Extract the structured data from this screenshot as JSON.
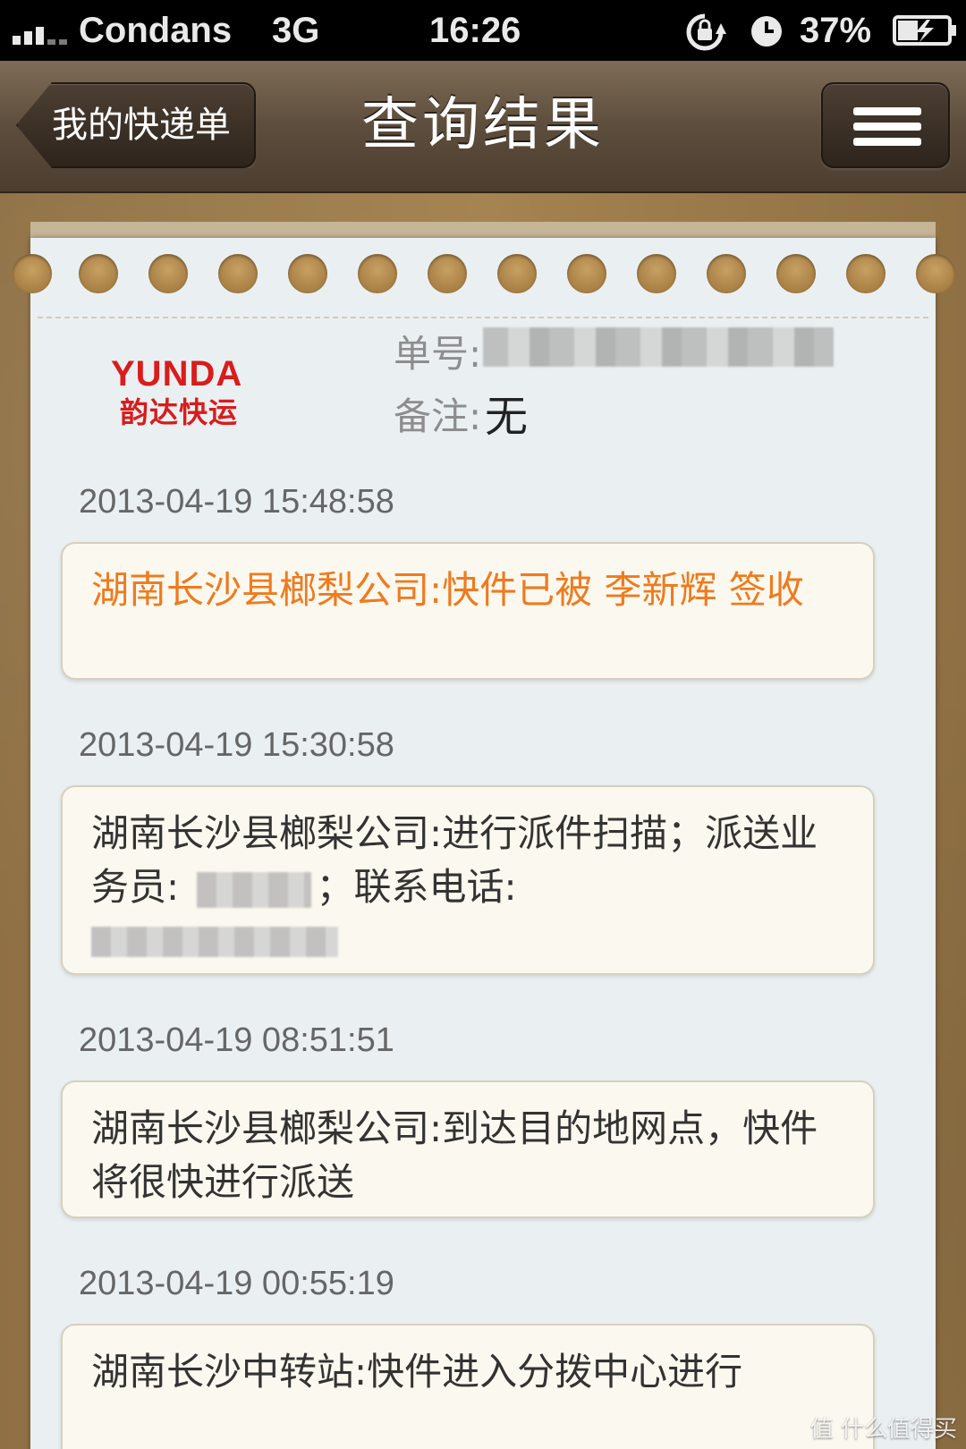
{
  "status_bar": {
    "carrier": "Condans",
    "network": "3G",
    "time": "16:26",
    "battery": "37%"
  },
  "nav": {
    "back_label": "我的快递单",
    "title": "查询结果",
    "menu_icon": "hamburger-menu-icon"
  },
  "shipment": {
    "logo_en": "YUNDA",
    "logo_cn": "韵达快运",
    "tracking_label": "单号:",
    "note_label": "备注:",
    "note_value": "无"
  },
  "events": [
    {
      "time": "2013-04-19 15:48:58",
      "text": "湖南长沙县榔梨公司:快件已被 李新辉 签收",
      "highlight": true
    },
    {
      "time": "2013-04-19 15:30:58",
      "text_a": "湖南长沙县榔梨公司:进行派件扫描；派送业务员:",
      "text_b": "；联系电话:",
      "highlight": false
    },
    {
      "time": "2013-04-19 08:51:51",
      "text": "湖南长沙县榔梨公司:到达目的地网点，快件将很快进行派送",
      "highlight": false
    },
    {
      "time": "2013-04-19 00:55:19",
      "text": "湖南长沙中转站:快件进入分拨中心进行",
      "highlight": false
    }
  ],
  "watermark": "值 什么值得买",
  "colors": {
    "highlight": "#f07a1e",
    "logo_red": "#d91c1c",
    "paper": "#eaf0f2"
  }
}
